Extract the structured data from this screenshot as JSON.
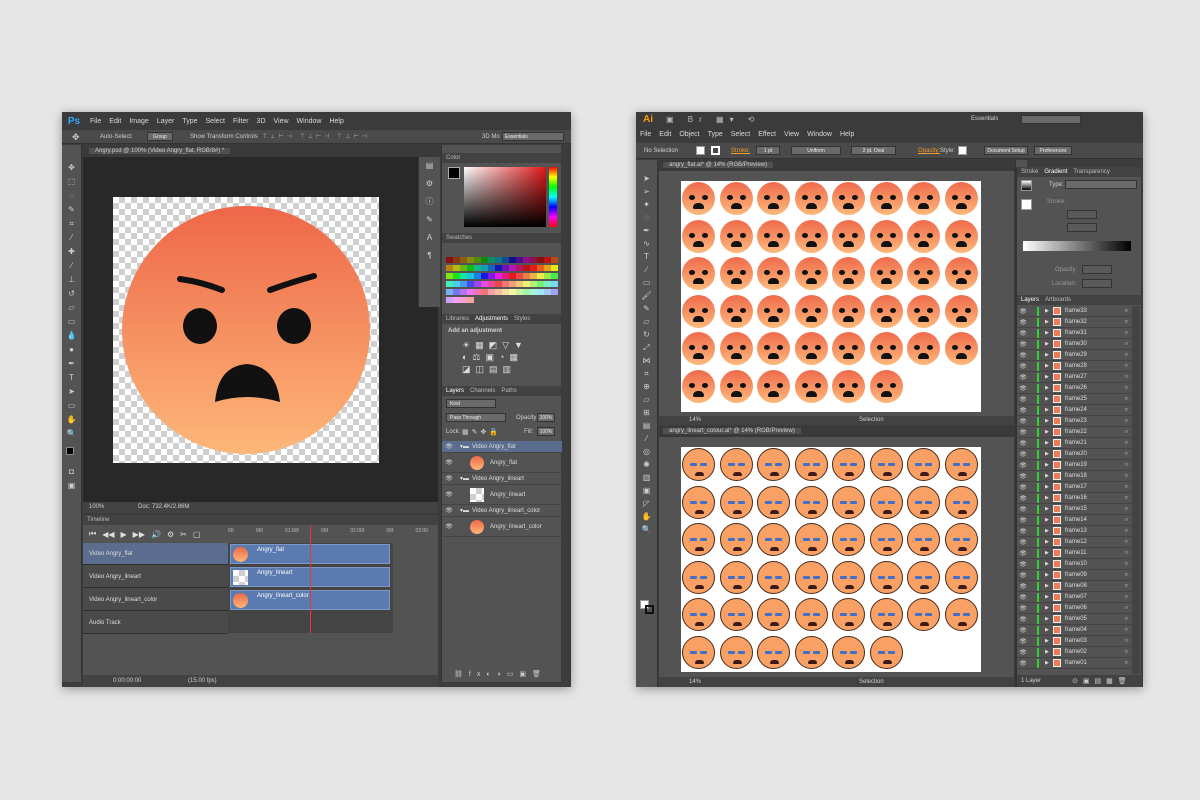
{
  "photoshop": {
    "logo": "Ps",
    "menu": [
      "File",
      "Edit",
      "Image",
      "Layer",
      "Type",
      "Select",
      "Filter",
      "3D",
      "View",
      "Window",
      "Help"
    ],
    "options": {
      "auto_select": "Auto-Select:",
      "group": "Group",
      "show_transform": "Show Transform Controls",
      "mode_3d": "3D Mo",
      "workspace": "Essentials"
    },
    "doc_tab": "Angry.psd @ 100% (Video Angry_flat, RGB/8#) *",
    "status": {
      "zoom": "100%",
      "doc": "Doc: 732.4K/2.86M"
    },
    "color_panel": {
      "title": "Color"
    },
    "swatches_panel": {
      "title": "Swatches"
    },
    "adjustments": {
      "tabs": [
        "Libraries",
        "Adjustments",
        "Styles"
      ],
      "add_label": "Add an adjustment"
    },
    "layers": {
      "tabs": [
        "Layers",
        "Channels",
        "Paths"
      ],
      "kind": "Kind",
      "blend": "Pass Through",
      "opacity_label": "Opacity:",
      "opacity_value": "100%",
      "lock_label": "Lock:",
      "fill_label": "Fill:",
      "fill_value": "100%",
      "items": [
        {
          "name": "Video Angry_flat",
          "type": "group"
        },
        {
          "name": "Angry_flat",
          "type": "layer"
        },
        {
          "name": "Video Angry_lineart",
          "type": "group"
        },
        {
          "name": "Angry_lineart",
          "type": "layer"
        },
        {
          "name": "Video Angry_lineart_color",
          "type": "group"
        },
        {
          "name": "Angry_lineart_color",
          "type": "layer"
        }
      ]
    },
    "timeline": {
      "title": "Timeline",
      "ruler": [
        "00",
        "06f",
        "01:00f",
        "06f",
        "02:00f",
        "06f",
        "03:00"
      ],
      "tracks": [
        "Video Angry_flat",
        "Video Angry_lineart",
        "Video Angry_lineart_color"
      ],
      "clips": [
        "Angry_flat",
        "Angry_lineart",
        "Angry_lineart_color"
      ],
      "audio": "Audio Track",
      "timecode": "0:00:00:00",
      "fps": "(15.00 fps)"
    },
    "emoji_color_top": "#ee6748",
    "emoji_color_bottom": "#fdb779"
  },
  "illustrator": {
    "logo": "Ai",
    "workspace": "Essentials",
    "menu": [
      "File",
      "Edit",
      "Object",
      "Type",
      "Select",
      "Effect",
      "View",
      "Window",
      "Help"
    ],
    "control": {
      "selection": "No Selection",
      "stroke": "Stroke:",
      "stroke_value": "1 pt",
      "profile": "Uniform",
      "brush": "2 pt. Oval",
      "opacity": "Opacity:",
      "style": "Style:",
      "doc_setup": "Document Setup",
      "preferences": "Preferences"
    },
    "doc1": {
      "tab": "angry_flat.ai* @ 14% (RGB/Preview)",
      "zoom": "14%",
      "status": "Selection"
    },
    "doc2": {
      "tab": "angry_lineart_colour.ai* @ 14% (RGB/Preview)",
      "zoom": "14%",
      "status": "Selection"
    },
    "stroke_panel": {
      "tabs": [
        "Stroke",
        "Gradient",
        "Transparency"
      ],
      "type_label": "Type:",
      "stroke_label": "Stroke:",
      "opacity_label": "Opacity:",
      "location_label": "Location:"
    },
    "layers_panel": {
      "tabs": [
        "Layers",
        "Artboards"
      ],
      "frames": [
        "frame33",
        "frame32",
        "frame31",
        "frame30",
        "frame29",
        "frame28",
        "frame27",
        "frame26",
        "frame25",
        "frame24",
        "frame23",
        "frame22",
        "frame21",
        "frame20",
        "frame19",
        "frame18",
        "frame17",
        "frame16",
        "frame15",
        "frame14",
        "frame13",
        "frame12",
        "frame11",
        "frame10",
        "frame09",
        "frame08",
        "frame07",
        "frame06",
        "frame05",
        "frame04",
        "frame03",
        "frame02",
        "frame01"
      ],
      "footer": "1 Layer"
    }
  }
}
